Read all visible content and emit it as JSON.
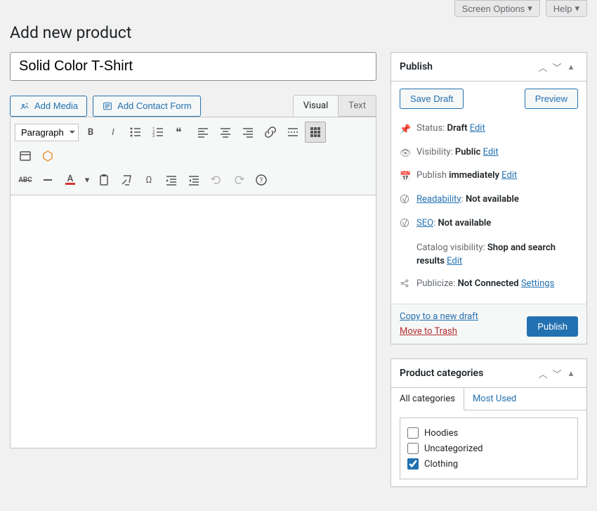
{
  "topbar": {
    "screen_options": "Screen Options",
    "help": "Help"
  },
  "page_title": "Add new product",
  "title_value": "Solid Color T-Shirt",
  "editor": {
    "add_media": "Add Media",
    "add_contact": "Add Contact Form",
    "tab_visual": "Visual",
    "tab_text": "Text",
    "format": "Paragraph"
  },
  "publish": {
    "title": "Publish",
    "save_draft": "Save Draft",
    "preview": "Preview",
    "status_label": "Status: ",
    "status_value": "Draft",
    "edit": "Edit",
    "visibility_label": "Visibility: ",
    "visibility_value": "Public",
    "publish_label": "Publish ",
    "publish_value": "immediately",
    "readability_label": "Readability",
    "readability_sep": ": ",
    "readability_value": "Not available",
    "seo_label": "SEO",
    "seo_sep": ": ",
    "seo_value": "Not available",
    "catalog_label": "Catalog visibility: ",
    "catalog_value": "Shop and search results",
    "publicize_label": "Publicize: ",
    "publicize_value": "Not Connected",
    "settings": "Settings",
    "copy_draft": "Copy to a new draft",
    "move_trash": "Move to Trash",
    "publish_btn": "Publish"
  },
  "categories": {
    "title": "Product categories",
    "tab_all": "All categories",
    "tab_most": "Most Used",
    "items": [
      {
        "label": "Hoodies",
        "checked": false
      },
      {
        "label": "Uncategorized",
        "checked": false
      },
      {
        "label": "Clothing",
        "checked": true
      }
    ]
  }
}
